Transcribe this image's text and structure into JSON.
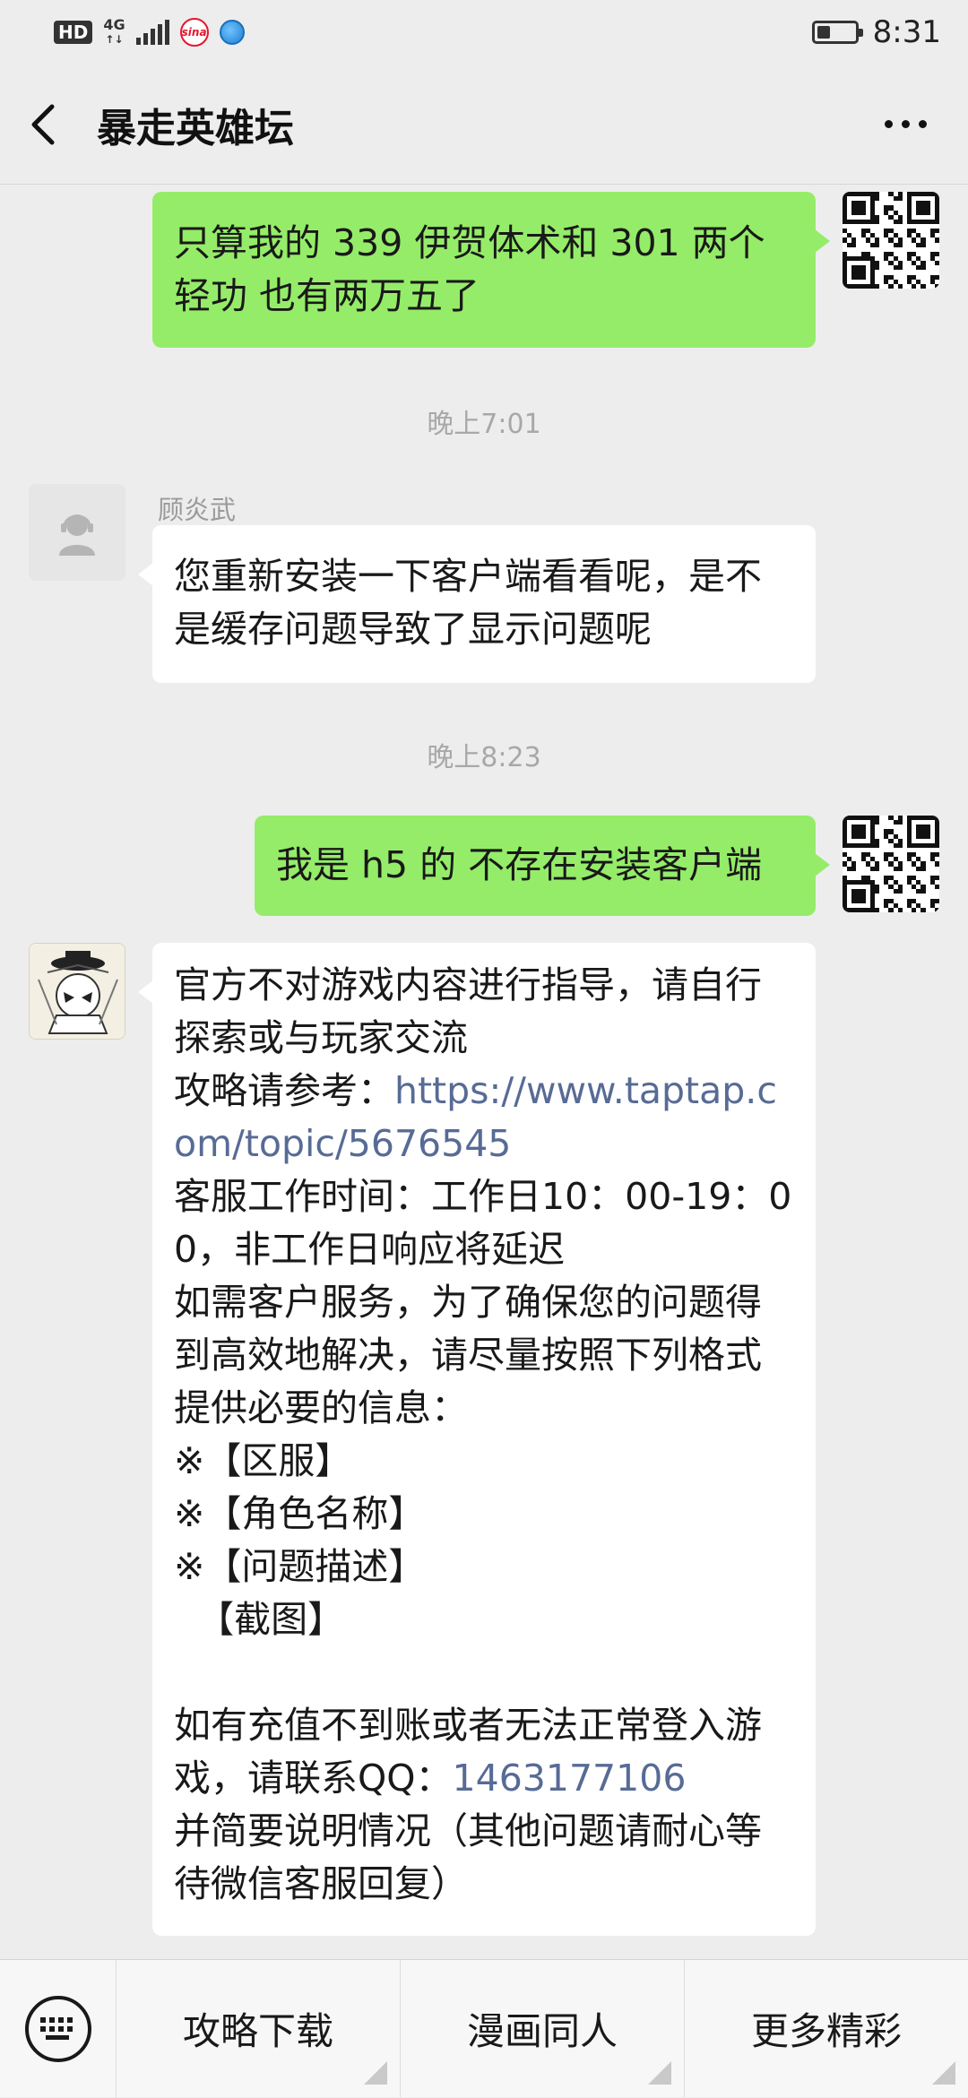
{
  "status_bar": {
    "hd": "HD",
    "network": "4G",
    "network_sub": "↑↓",
    "sina": "sina",
    "time": "8:31",
    "battery_level": 0.35
  },
  "nav": {
    "title": "暴走英雄坛"
  },
  "messages": {
    "m1": {
      "text": "只算我的 339 伊贺体术和 301 两个轻功 也有两万五了"
    },
    "t1": {
      "text": "晚上7:01"
    },
    "m2": {
      "sender": "顾炎武",
      "text": "您重新安装一下客户端看看呢，是不是缓存问题导致了显示问题呢"
    },
    "t2": {
      "text": "晚上8:23"
    },
    "m3": {
      "text": "我是 h5 的 不存在安装客户端"
    },
    "m4": {
      "line1": "官方不对游戏内容进行指导，请自行探索或与玩家交流",
      "guide_prefix": "攻略请参考：",
      "guide_link": "https://www.taptap.com/topic/5676545",
      "hours": "客服工作时间：工作日10：00-19：00，非工作日响应将延迟",
      "service": "如需客户服务，为了确保您的问题得到高效地解决，请尽量按照下列格式提供必要的信息：",
      "item1": "※【区服】",
      "item2": "※【角色名称】",
      "item3": "※【问题描述】",
      "item4": "  【截图】",
      "recharge_prefix": "如有充值不到账或者无法正常登入游戏，请联系QQ：",
      "qq": "1463177106",
      "recharge_suffix": "并简要说明情况（其他问题请耐心等待微信客服回复）"
    }
  },
  "bottom_menu": {
    "items": [
      {
        "label": "攻略下载"
      },
      {
        "label": "漫画同人"
      },
      {
        "label": "更多精彩"
      }
    ]
  },
  "colors": {
    "out_bubble": "#95ec69",
    "in_bubble": "#ffffff",
    "link": "#576b95",
    "background": "#ededed"
  },
  "icons": [
    "back-arrow-icon",
    "more-dots-icon",
    "keyboard-icon",
    "customer-service-icon",
    "qr-code-avatar"
  ]
}
